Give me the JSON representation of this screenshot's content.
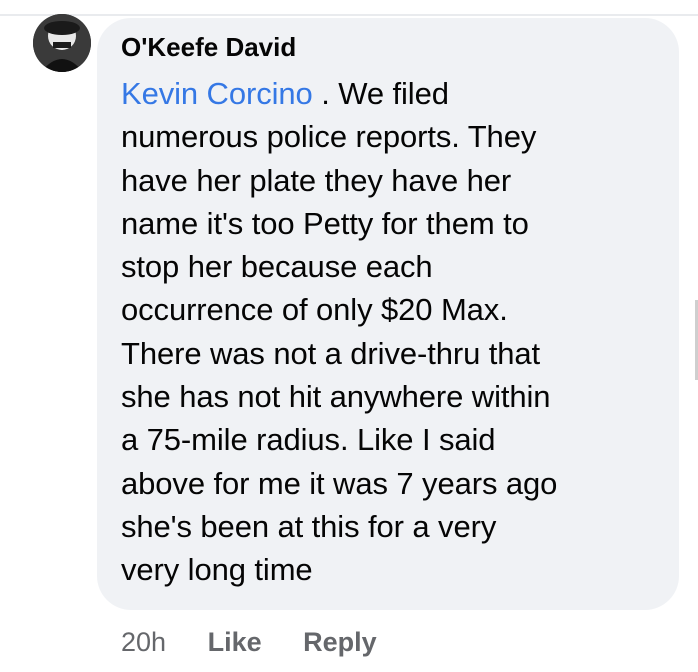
{
  "comment": {
    "author": "O'Keefe David",
    "mention": "Kevin Corcino",
    "lines": [
      " . We filed",
      "numerous police reports. They",
      "have her plate they have her",
      "name it's too Petty for them to",
      "stop her because each",
      "occurrence of only $20 Max.",
      "There was not a drive-thru that",
      "she has not hit anywhere within",
      "a 75-mile radius. Like I said",
      "above for me it was 7 years ago",
      "she's been at this for a very",
      "very long time"
    ],
    "timestamp": "20h",
    "like_label": "Like",
    "reply_label": "Reply"
  },
  "colors": {
    "bubble": "#f0f2f5",
    "mention": "#3578e5",
    "text": "#050505",
    "meta": "#65676b"
  },
  "icons": {
    "avatar": "profile-photo"
  }
}
